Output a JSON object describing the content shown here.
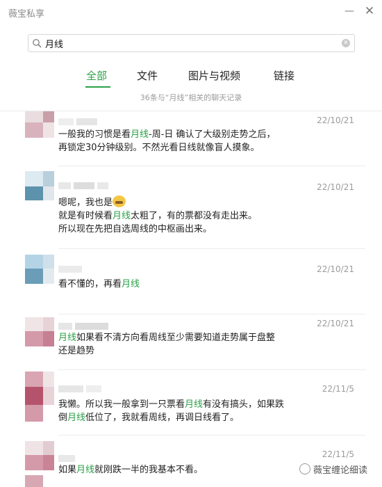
{
  "app": {
    "title": "薇宝私享",
    "minimize_glyph": "—",
    "close_glyph": "✕"
  },
  "search": {
    "value": "月线",
    "placeholder": ""
  },
  "tabs": [
    {
      "label": "全部",
      "active": true
    },
    {
      "label": "文件",
      "active": false
    },
    {
      "label": "图片与视频",
      "active": false
    },
    {
      "label": "链接",
      "active": false
    }
  ],
  "summary": "36条与“月线”相关的聊天记录",
  "keyword_color": "#2aa046",
  "results": [
    {
      "date": "22/10/21",
      "lines": [
        [
          "一般我的习惯是看",
          {
            "hl": "月线"
          },
          "-周-日 确认了大级别走势之后，"
        ],
        [
          "再锁定30分钟级别。不然光看日线就像盲人摸象。"
        ]
      ]
    },
    {
      "date": "22/10/21",
      "lines": [
        [
          "嗯呢，我也是",
          {
            "emoji": "laughing-face"
          }
        ],
        [
          "就是有时候看",
          {
            "hl": "月线"
          },
          "太粗了，有的票都没有走出来。"
        ],
        [
          "所以现在先把自选周线的中枢画出来。"
        ]
      ]
    },
    {
      "date": "22/10/21",
      "lines": [
        [
          "看不懂的，再看",
          {
            "hl": "月线"
          }
        ]
      ]
    },
    {
      "date": "22/10/21",
      "lines": [
        [
          {
            "hl": "月线"
          },
          "如果看不清方向看周线至少需要知道走势属于盘整"
        ],
        [
          "还是趋势"
        ]
      ]
    },
    {
      "date": "22/11/5",
      "lines": [
        [
          "我懒。所以我一般拿到一只票看",
          {
            "hl": "月线"
          },
          "有没有搞头，如果跌"
        ],
        [
          "倒",
          {
            "hl": "月线"
          },
          "低位了，我就看周线，再调日线看了。"
        ]
      ]
    },
    {
      "date": "22/11/5",
      "lines": [
        [
          "如果",
          {
            "hl": "月线"
          },
          "就刚跌一半的我基本不看。"
        ]
      ]
    }
  ],
  "watermark": "薇宝缠论细读"
}
